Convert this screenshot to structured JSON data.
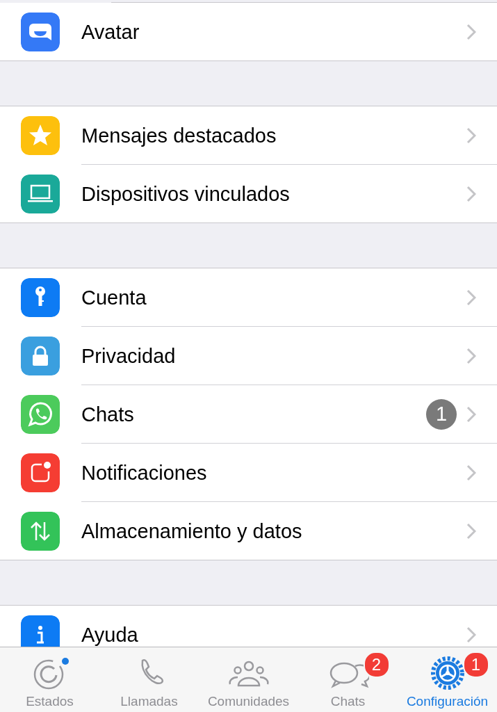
{
  "sections": [
    {
      "items": [
        {
          "label": "Avatar",
          "kind": "avatar"
        }
      ]
    },
    {
      "items": [
        {
          "label": "Mensajes destacados",
          "kind": "star"
        },
        {
          "label": "Dispositivos vinculados",
          "kind": "laptop"
        }
      ]
    },
    {
      "items": [
        {
          "label": "Cuenta",
          "kind": "key"
        },
        {
          "label": "Privacidad",
          "kind": "lock"
        },
        {
          "label": "Chats",
          "kind": "chat",
          "badge": "1"
        },
        {
          "label": "Notificaciones",
          "kind": "notif"
        },
        {
          "label": "Almacenamiento y datos",
          "kind": "storage"
        }
      ]
    },
    {
      "items": [
        {
          "label": "Ayuda",
          "kind": "info"
        }
      ]
    }
  ],
  "tab_bar": [
    {
      "label": "Estados",
      "kind": "status",
      "selected": false,
      "dot": true
    },
    {
      "label": "Llamadas",
      "kind": "phone",
      "selected": false
    },
    {
      "label": "Comunidades",
      "kind": "people",
      "selected": false
    },
    {
      "label": "Chats",
      "kind": "chats",
      "selected": false,
      "badge": "2"
    },
    {
      "label": "Configuración",
      "kind": "gear",
      "selected": true,
      "badge": "1"
    }
  ]
}
